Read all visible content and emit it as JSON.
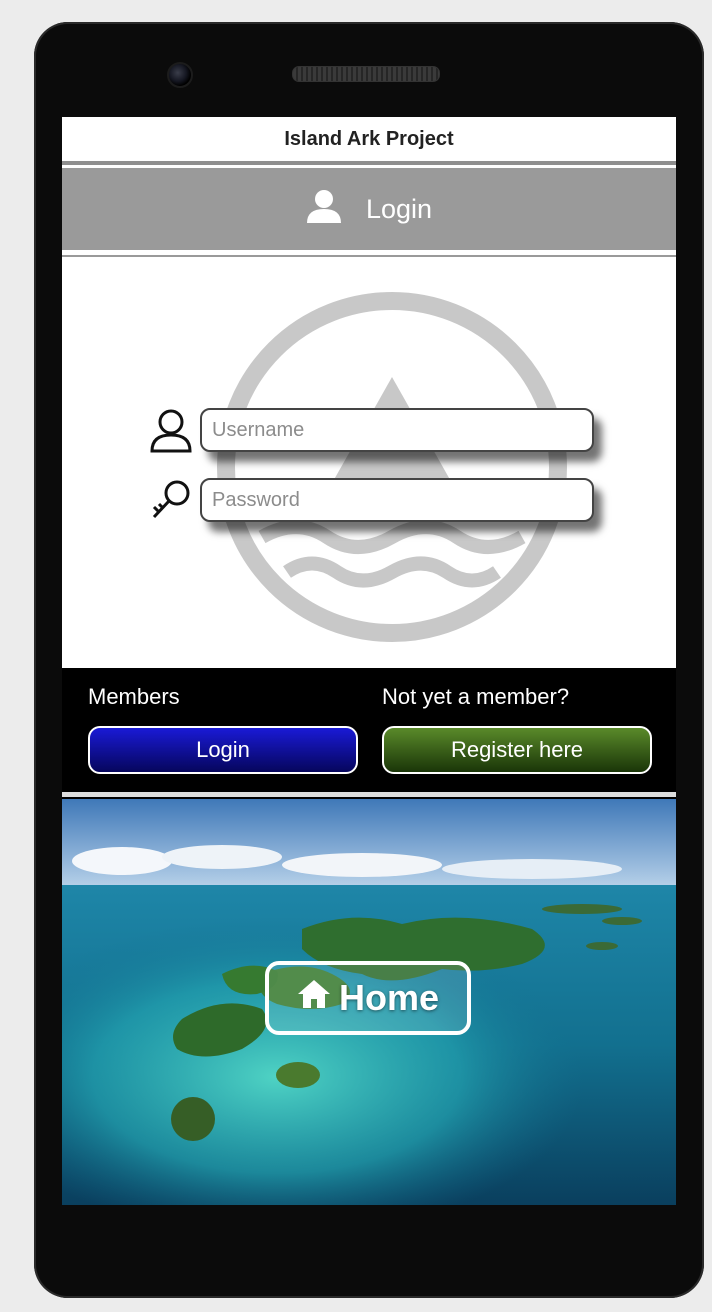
{
  "app": {
    "title": "Island Ark Project"
  },
  "header": {
    "label": "Login",
    "icon": "user-icon"
  },
  "form": {
    "username_placeholder": "Username",
    "password_placeholder": "Password",
    "username_icon": "user-outline-icon",
    "password_icon": "key-icon"
  },
  "members": {
    "members_label": "Members",
    "login_button": "Login",
    "nonmember_label": "Not yet a member?",
    "register_button": "Register here"
  },
  "hero": {
    "home_button": "Home",
    "home_icon": "home-icon"
  },
  "colors": {
    "header_bg": "#9a9a9a",
    "login_button": "#1a1ad6",
    "register_button": "#3f6a1c",
    "members_bar_bg": "#000000"
  }
}
